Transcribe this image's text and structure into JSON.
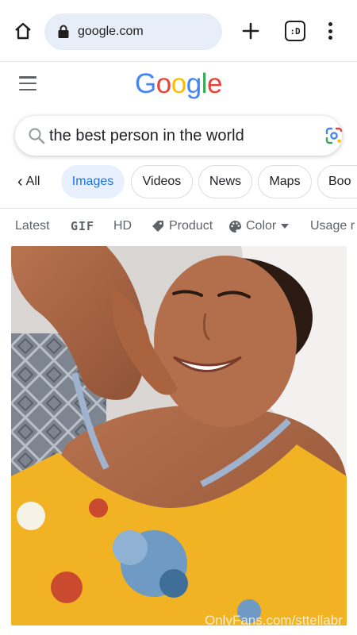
{
  "browser": {
    "url": "google.com",
    "tabs_count": ":D"
  },
  "logo": {
    "letters": [
      "G",
      "o",
      "o",
      "g",
      "l",
      "e"
    ],
    "colors": [
      "#4285F4",
      "#EA4335",
      "#FBBC05",
      "#4285F4",
      "#34A853",
      "#EA4335"
    ]
  },
  "search": {
    "query": "the best person in the world"
  },
  "chips": {
    "back_label": "All",
    "items": [
      "Images",
      "Videos",
      "News",
      "Maps",
      "Boo"
    ],
    "active": "Images"
  },
  "tools": {
    "latest": "Latest",
    "gif": "GIF",
    "hd": "HD",
    "product": "Product",
    "color": "Color",
    "usage": "Usage r"
  },
  "result": {
    "watermark": "OnlyFans.com/sttellabr"
  },
  "colors": {
    "accent": "#1a73e8",
    "chip_active_bg": "#e8f0fe",
    "url_bar_bg": "#e8eef7"
  }
}
